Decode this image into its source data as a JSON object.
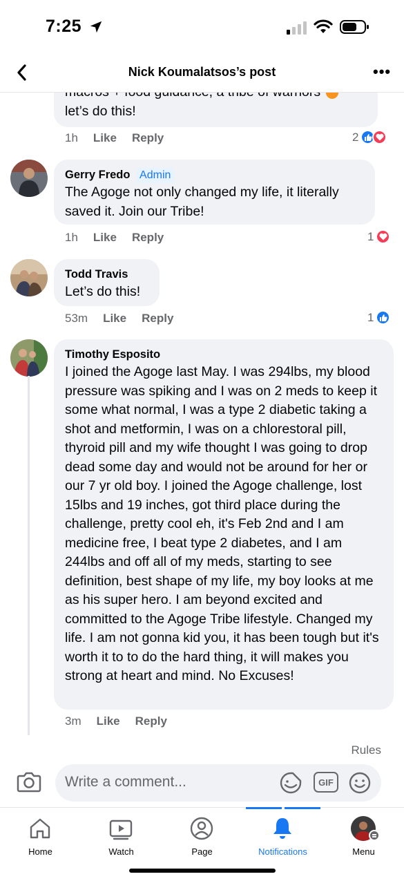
{
  "status": {
    "time": "7:25"
  },
  "nav": {
    "title": "Nick Koumalatsos’s post"
  },
  "comments": [
    {
      "text_line1": "macros + food guidance, a tribe of warriors",
      "text_line2": "let’s do this!",
      "time": "1h",
      "like": "Like",
      "reply": "Reply",
      "reaction_count": "2"
    },
    {
      "author": "Gerry Fredo",
      "badge": "Admin",
      "text": "The Agoge not only changed my life, it literally saved it. Join our Tribe!",
      "time": "1h",
      "like": "Like",
      "reply": "Reply",
      "reaction_count": "1"
    },
    {
      "author": "Todd Travis",
      "text": "Let’s do this!",
      "time": "53m",
      "like": "Like",
      "reply": "Reply",
      "reaction_count": "1"
    },
    {
      "author": "Timothy Esposito",
      "text": "I joined the Agoge last May.  I was 294lbs, my blood pressure was spiking and I was on 2 meds to keep it some what normal, I was a type 2 diabetic taking a shot and metformin, I was on a chlorestoral pill, thyroid pill and my wife thought I was going to drop dead some day and would not be around for her or our 7 yr old boy.  I joined the Agoge challenge, lost 15lbs and 19 inches, got third place during the challenge, pretty cool eh, it's Feb 2nd and I am medicine free, I beat type 2 diabetes, and I am 244lbs and off all of my meds, starting to see definition, best shape of my life, my boy looks at me as his super hero.  I am beyond excited and committed to the Agoge Tribe lifestyle.  Changed my life.  I am not gonna kid you, it has been tough but it's worth it to to do the hard thing, it will makes you strong at heart and mind.  No Excuses!",
      "time": "3m",
      "like": "Like",
      "reply": "Reply"
    }
  ],
  "composer": {
    "rules": "Rules",
    "placeholder": "Write a comment...",
    "gif": "GIF"
  },
  "tabs": [
    {
      "label": "Home",
      "icon": "home-icon"
    },
    {
      "label": "Watch",
      "icon": "watch-icon"
    },
    {
      "label": "Page",
      "icon": "page-icon"
    },
    {
      "label": "Notifications",
      "icon": "bell-icon",
      "active": true
    },
    {
      "label": "Menu",
      "icon": "menu-avatar-icon"
    }
  ],
  "colors": {
    "accent": "#1877f2",
    "love": "#f33e58",
    "bubble": "#f0f2f5",
    "muted": "#65676b"
  }
}
